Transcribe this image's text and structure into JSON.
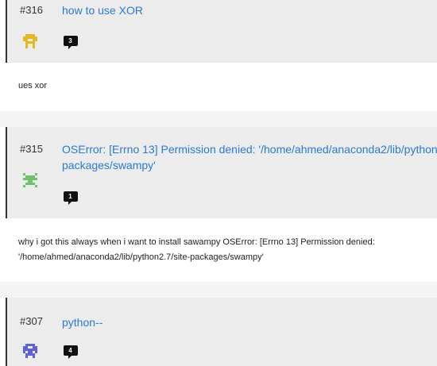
{
  "issues": [
    {
      "number": "#316",
      "title_lines": [
        "how to use XOR"
      ],
      "comments": "3",
      "body_lines": [
        "ues xor"
      ],
      "avatar_icon": "pixel-avatar-yellow-icon",
      "avatar_color": "#e3b820"
    },
    {
      "number": "#315",
      "title_lines": [
        "OSError: [Errno 13] Permission denied: '/home/ahmed/anaconda2/lib/python",
        "packages/swampy'"
      ],
      "comments": "1",
      "body_lines": [
        "why i got this always when i want to install sawampy OSError: [Errno 13] Permission denied:",
        "'/home/ahmed/anaconda2/lib/python2.7/site-packages/swampy'"
      ],
      "avatar_icon": "pixel-avatar-green-icon",
      "avatar_color": "#6cc36a"
    },
    {
      "number": "#307",
      "title_lines": [
        "python--"
      ],
      "comments": "4",
      "body_lines": [],
      "avatar_icon": "pixel-avatar-purple-icon",
      "avatar_color": "#5f63d9"
    }
  ],
  "colors": {
    "card_bg": "#ececec",
    "link": "#2a7ad0",
    "badge": "#111111",
    "page_bg": "#f4f4f4"
  }
}
